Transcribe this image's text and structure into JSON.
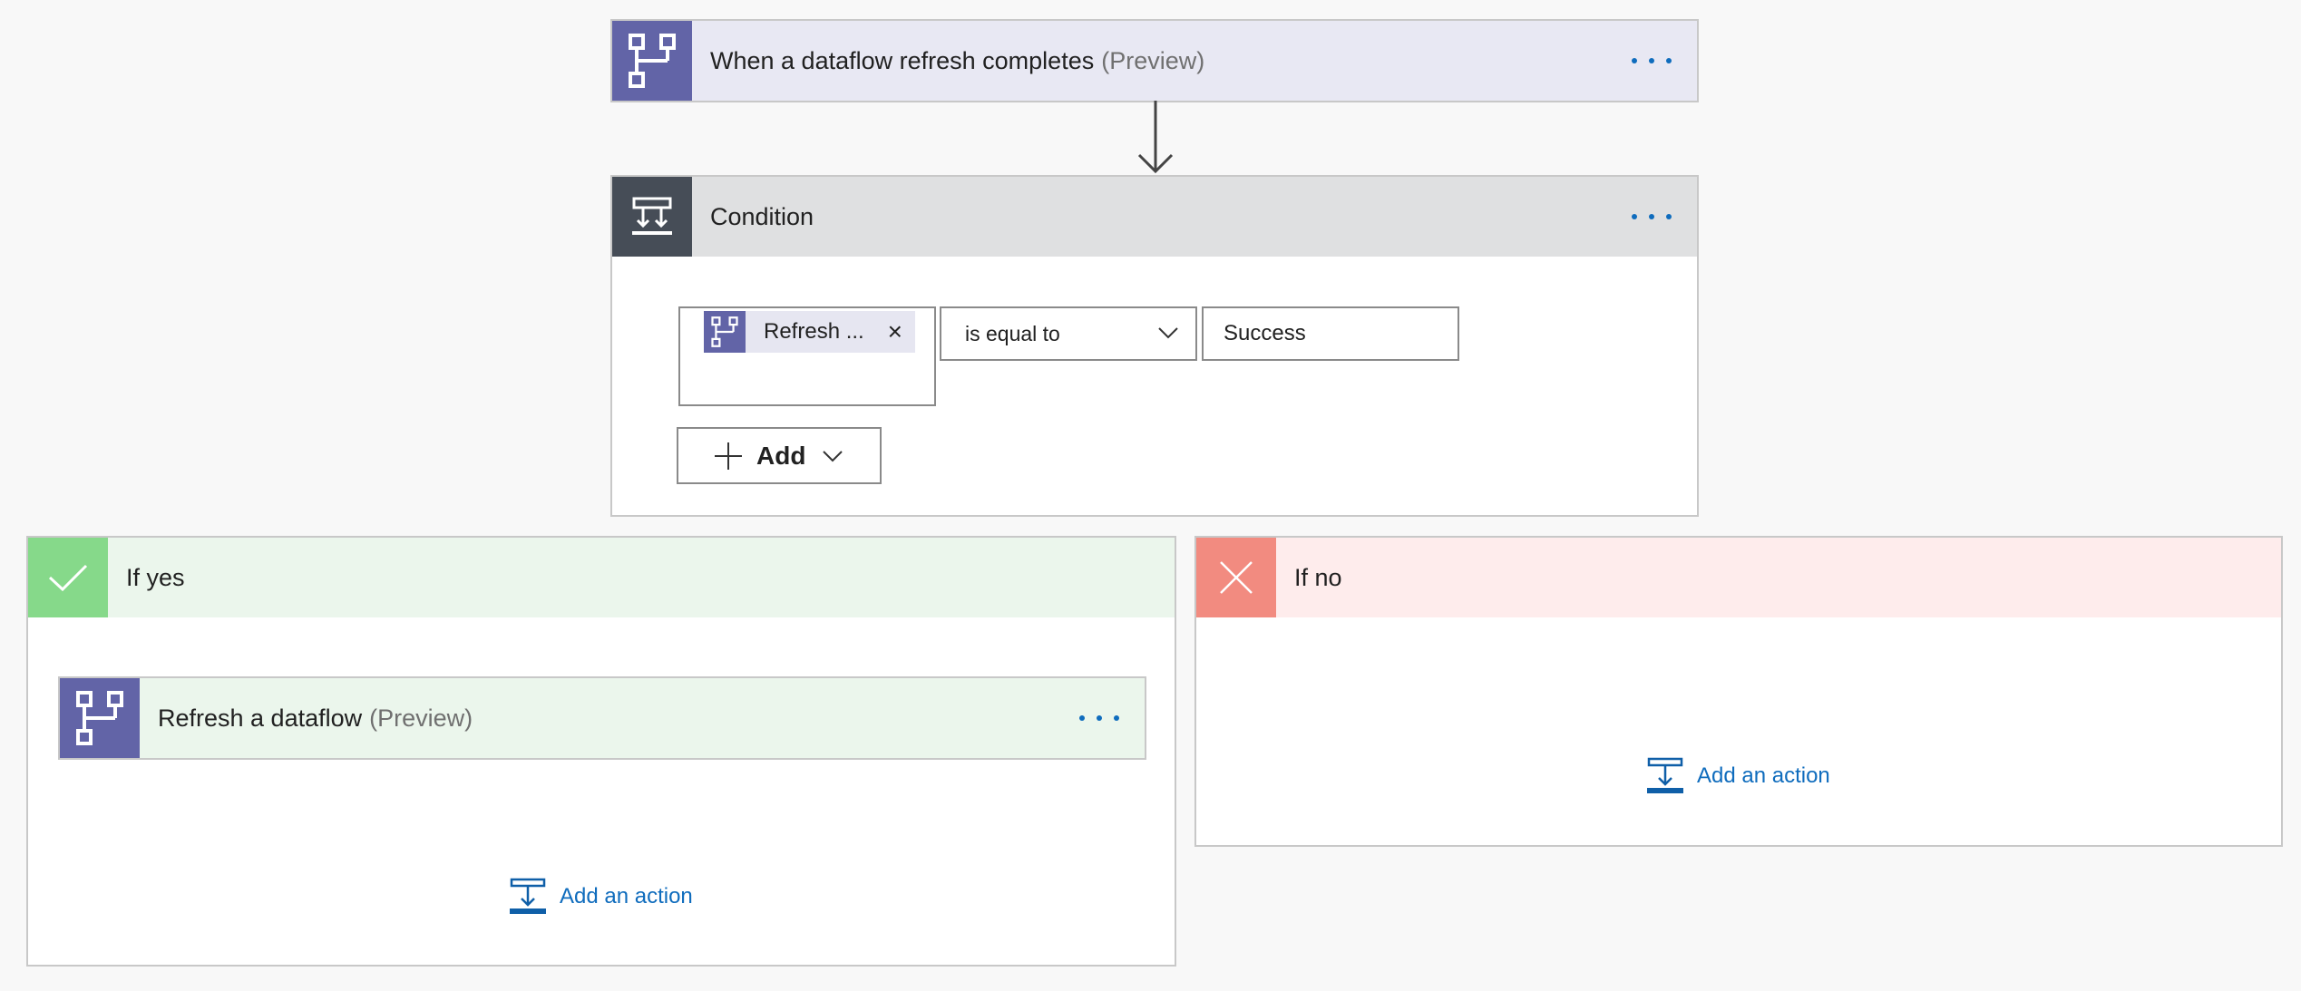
{
  "colors": {
    "dataflow_purple": "#6264a7",
    "condition_dark": "#464d57",
    "yes_green": "#86d98a",
    "no_red": "#f28b80",
    "link_blue": "#0f6cbd"
  },
  "trigger": {
    "icon": "dataflow-icon",
    "title": "When a dataflow refresh completes",
    "subtitle": "(Preview)"
  },
  "condition": {
    "icon": "condition-icon",
    "title": "Condition",
    "token_label": "Refresh ...",
    "token_close": "×",
    "operator": "is equal to",
    "value": "Success",
    "add_label": "Add"
  },
  "if_yes": {
    "icon": "check-icon",
    "title": "If yes",
    "action": {
      "icon": "dataflow-icon",
      "title": "Refresh a dataflow",
      "subtitle": "(Preview)"
    },
    "add_action_label": "Add an action"
  },
  "if_no": {
    "icon": "close-icon",
    "title": "If no",
    "add_action_label": "Add an action"
  }
}
